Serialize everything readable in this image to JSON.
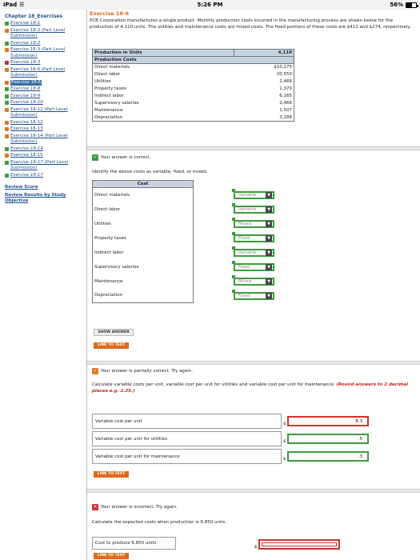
{
  "status_bar": {
    "device": "iPad",
    "time": "5:26 PM",
    "battery": "56%"
  },
  "sidebar": {
    "chapter": "Chapter 18_Exercises",
    "items": [
      {
        "label": "Exercise 18-1",
        "status": "correct",
        "italic": true
      },
      {
        "label": "Exercise 18-2 (Part Level Submission)",
        "status": "partial",
        "italic": false
      },
      {
        "label": "Exercise 18-2",
        "status": "correct",
        "italic": true
      },
      {
        "label": "Exercise 18-3 (Part Level Submission)",
        "status": "partial",
        "italic": false
      },
      {
        "label": "Exercise 18-3",
        "status": "incorrect",
        "italic": true
      },
      {
        "label": "Exercise 18-6 (Part Level Submission)",
        "status": "partial",
        "italic": false
      },
      {
        "label": "Exercise 18-6",
        "status": "partial",
        "italic": false,
        "current": true
      },
      {
        "label": "Exercise 18-8",
        "status": "correct",
        "italic": true
      },
      {
        "label": "Exercise 18-9",
        "status": "correct",
        "italic": true
      },
      {
        "label": "Exercise 18-10",
        "status": "correct",
        "italic": true
      },
      {
        "label": "Exercise 18-12 (Part Level Submission)",
        "status": "partial",
        "italic": false
      },
      {
        "label": "Exercise 18-12",
        "status": "partial",
        "italic": false
      },
      {
        "label": "Exercise 18-13",
        "status": "partial",
        "italic": false
      },
      {
        "label": "Exercise 18-14 (Part Level Submission)",
        "status": "partial",
        "italic": false
      },
      {
        "label": "Exercise 18-14",
        "status": "correct",
        "italic": true
      },
      {
        "label": "Exercise 18-15",
        "status": "partial",
        "italic": false
      },
      {
        "label": "Exercise 18-17 (Part Level Submission)",
        "status": "correct",
        "italic": true
      },
      {
        "label": "Exercise 18-17",
        "status": "correct",
        "italic": true
      }
    ],
    "review_score": "Review Score",
    "review_results": "Review Results by Study Objective"
  },
  "main": {
    "title": "Exercise 18-6",
    "intro": "PCB Corporation manufactures a single product. Monthly production costs incurred in the manufacturing process are shown below for the production of 4,110 units. The utilities and maintenance costs are mixed costs. The fixed portions of these costs are $411 and $274, respectively.",
    "prod_table": {
      "header_label": "Production in Units",
      "header_value": "4,110",
      "subheader": "Production Costs",
      "rows": [
        {
          "label": "Direct materials",
          "value": "$10,275"
        },
        {
          "label": "Direct labor",
          "value": "20,550"
        },
        {
          "label": "Utilities",
          "value": "2,466"
        },
        {
          "label": "Property taxes",
          "value": "1,370"
        },
        {
          "label": "Indirect labor",
          "value": "6,165"
        },
        {
          "label": "Supervisory salaries",
          "value": "2,466"
        },
        {
          "label": "Maintenance",
          "value": "1,507"
        },
        {
          "label": "Depreciation",
          "value": "3,288"
        }
      ]
    },
    "section1": {
      "feedback": "Your answer is correct.",
      "instruction": "Identify the above costs as variable, fixed, or mixed.",
      "cost_header": "Cost",
      "rows": [
        {
          "label": "Direct materials",
          "answer": "Variable"
        },
        {
          "label": "Direct labor",
          "answer": "Variable"
        },
        {
          "label": "Utilities",
          "answer": "Mixed"
        },
        {
          "label": "Property taxes",
          "answer": "Fixed"
        },
        {
          "label": "Indirect labor",
          "answer": "Variable"
        },
        {
          "label": "Supervisory salaries",
          "answer": "Fixed"
        },
        {
          "label": "Maintenance",
          "answer": "Mixed"
        },
        {
          "label": "Depreciation",
          "answer": "Fixed"
        }
      ],
      "show_answer": "SHOW ANSWER",
      "link_to_text": "LINK TO TEXT"
    },
    "section2": {
      "feedback": "Your answer is partially correct.  Try again.",
      "instruction": "Calculate variable costs per unit, variable cost per unit for utilities and variable cost per unit for maintenance.",
      "instruction_red": "(Round answers to 2 decimal places e.g. 2.25.)",
      "rows": [
        {
          "label": "Variable cost per unit",
          "currency": "$",
          "value": "8.3",
          "state": "incorrect"
        },
        {
          "label": "Variable cost per unit for utilities",
          "currency": "$",
          "value": ".5",
          "state": "correct"
        },
        {
          "label": "Variable cost per unit for maintenance",
          "currency": "$",
          "value": ".3",
          "state": "correct"
        }
      ],
      "link_to_text": "LINK TO TEXT"
    },
    "section3": {
      "feedback": "Your answer is incorrect.  Try again.",
      "instruction": "Calculate the expected costs when production is 6,850 units.",
      "label": "Cost to produce 6,850 units",
      "currency": "$",
      "value": "",
      "link_to_text": "LINK TO TEXT"
    }
  }
}
